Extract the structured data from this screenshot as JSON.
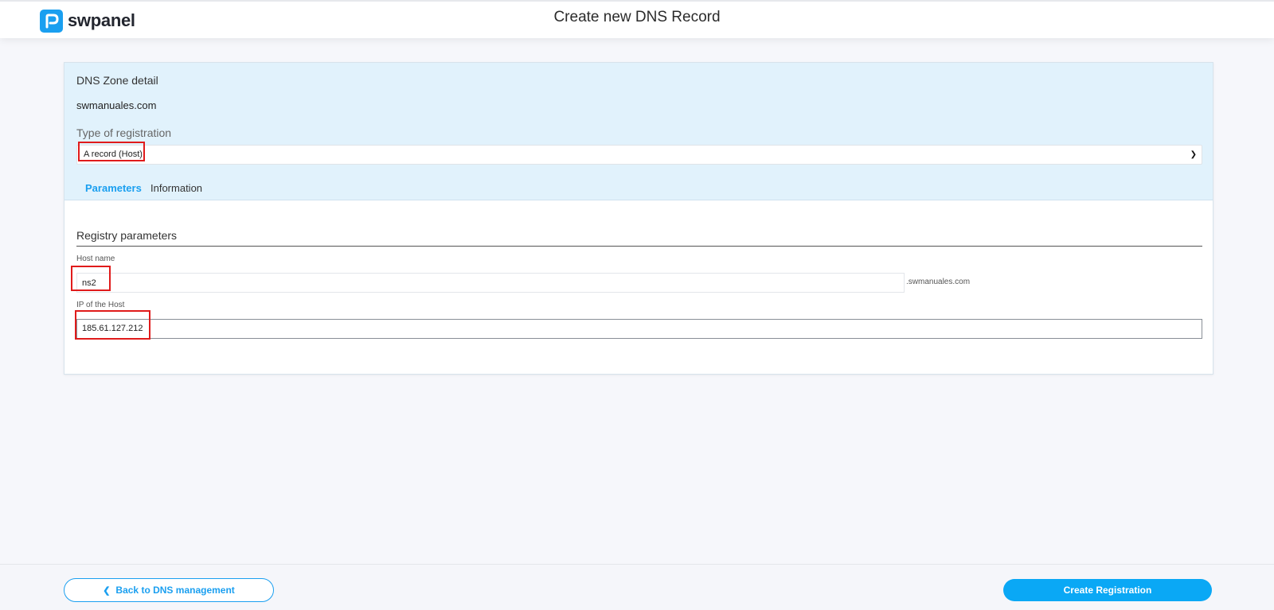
{
  "header": {
    "brand": "swpanel",
    "title": "Create new DNS Record"
  },
  "zone": {
    "section_label": "DNS Zone detail",
    "name": "swmanuales.com",
    "type_label": "Type of registration",
    "type_value": "A record (Host)"
  },
  "tabs": [
    {
      "label": "Parameters",
      "active": true
    },
    {
      "label": "Information",
      "active": false
    }
  ],
  "parameters": {
    "title": "Registry parameters",
    "host_label": "Host name",
    "host_value": "ns2",
    "host_suffix": ".swmanuales.com",
    "ip_label": "IP of the Host",
    "ip_value": "185.61.127.212"
  },
  "footer": {
    "back_label": "Back to DNS management",
    "create_label": "Create Registration"
  },
  "colors": {
    "accent": "#1a9ff0",
    "header_bg": "#e1f2fc",
    "highlight": "#e01b1b"
  },
  "icons": {
    "logo": "swpanel-logo-icon",
    "select": "chevron-down-icon",
    "back": "chevron-left-icon"
  }
}
